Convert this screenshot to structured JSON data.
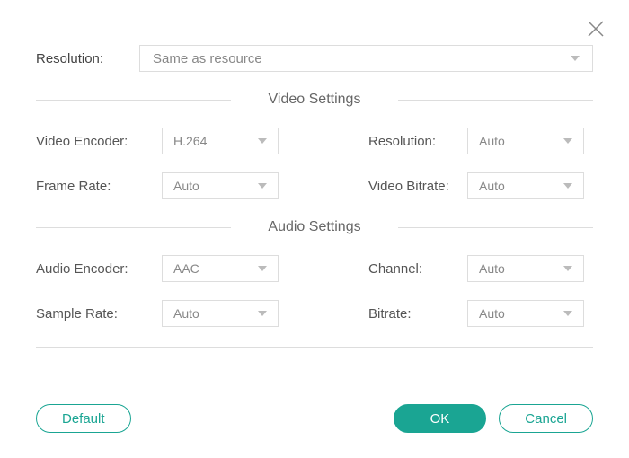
{
  "close": "close",
  "topResolution": {
    "label": "Resolution:",
    "value": "Same as resource"
  },
  "videoSection": {
    "title": "Video Settings",
    "encoder": {
      "label": "Video Encoder:",
      "value": "H.264"
    },
    "resolution": {
      "label": "Resolution:",
      "value": "Auto"
    },
    "frameRate": {
      "label": "Frame Rate:",
      "value": "Auto"
    },
    "bitrate": {
      "label": "Video Bitrate:",
      "value": "Auto"
    }
  },
  "audioSection": {
    "title": "Audio Settings",
    "encoder": {
      "label": "Audio Encoder:",
      "value": "AAC"
    },
    "channel": {
      "label": "Channel:",
      "value": "Auto"
    },
    "sampleRate": {
      "label": "Sample Rate:",
      "value": "Auto"
    },
    "bitrate": {
      "label": "Bitrate:",
      "value": "Auto"
    }
  },
  "buttons": {
    "default": "Default",
    "ok": "OK",
    "cancel": "Cancel"
  }
}
